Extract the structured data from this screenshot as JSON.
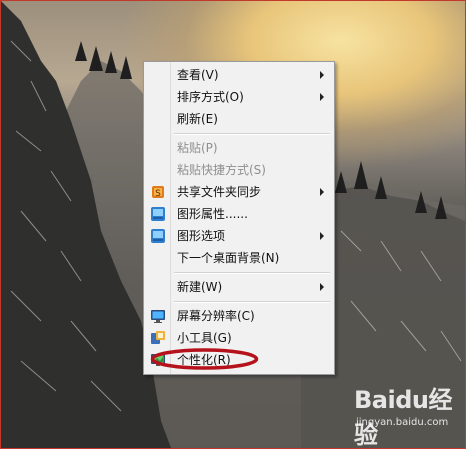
{
  "context_menu": {
    "items": [
      {
        "label": "查看(V)",
        "submenu": true,
        "disabled": false,
        "icon": null
      },
      {
        "label": "排序方式(O)",
        "submenu": true,
        "disabled": false,
        "icon": null
      },
      {
        "label": "刷新(E)",
        "submenu": false,
        "disabled": false,
        "icon": null
      },
      {
        "label": "粘贴(P)",
        "submenu": false,
        "disabled": true,
        "icon": null
      },
      {
        "label": "粘贴快捷方式(S)",
        "submenu": false,
        "disabled": true,
        "icon": null
      },
      {
        "label": "共享文件夹同步",
        "submenu": true,
        "disabled": false,
        "icon": "sync-folder-icon"
      },
      {
        "label": "图形属性......",
        "submenu": false,
        "disabled": false,
        "icon": "graphics-properties-icon"
      },
      {
        "label": "图形选项",
        "submenu": true,
        "disabled": false,
        "icon": "graphics-options-icon"
      },
      {
        "label": "下一个桌面背景(N)",
        "submenu": false,
        "disabled": false,
        "icon": null
      },
      {
        "label": "新建(W)",
        "submenu": true,
        "disabled": false,
        "icon": null
      },
      {
        "label": "屏幕分辨率(C)",
        "submenu": false,
        "disabled": false,
        "icon": "screen-resolution-icon"
      },
      {
        "label": "小工具(G)",
        "submenu": false,
        "disabled": false,
        "icon": "gadgets-icon"
      },
      {
        "label": "个性化(R)",
        "submenu": false,
        "disabled": false,
        "icon": "personalize-icon"
      }
    ],
    "highlighted_item": "个性化(R)"
  },
  "annotation": {
    "color": "#b5121b"
  },
  "watermark": {
    "brand": "Baidu经验",
    "domain": "jingyan.baidu.com"
  },
  "colors": {
    "menu_bg": "#f1f1f1",
    "disabled_text": "#8f8f8f"
  }
}
